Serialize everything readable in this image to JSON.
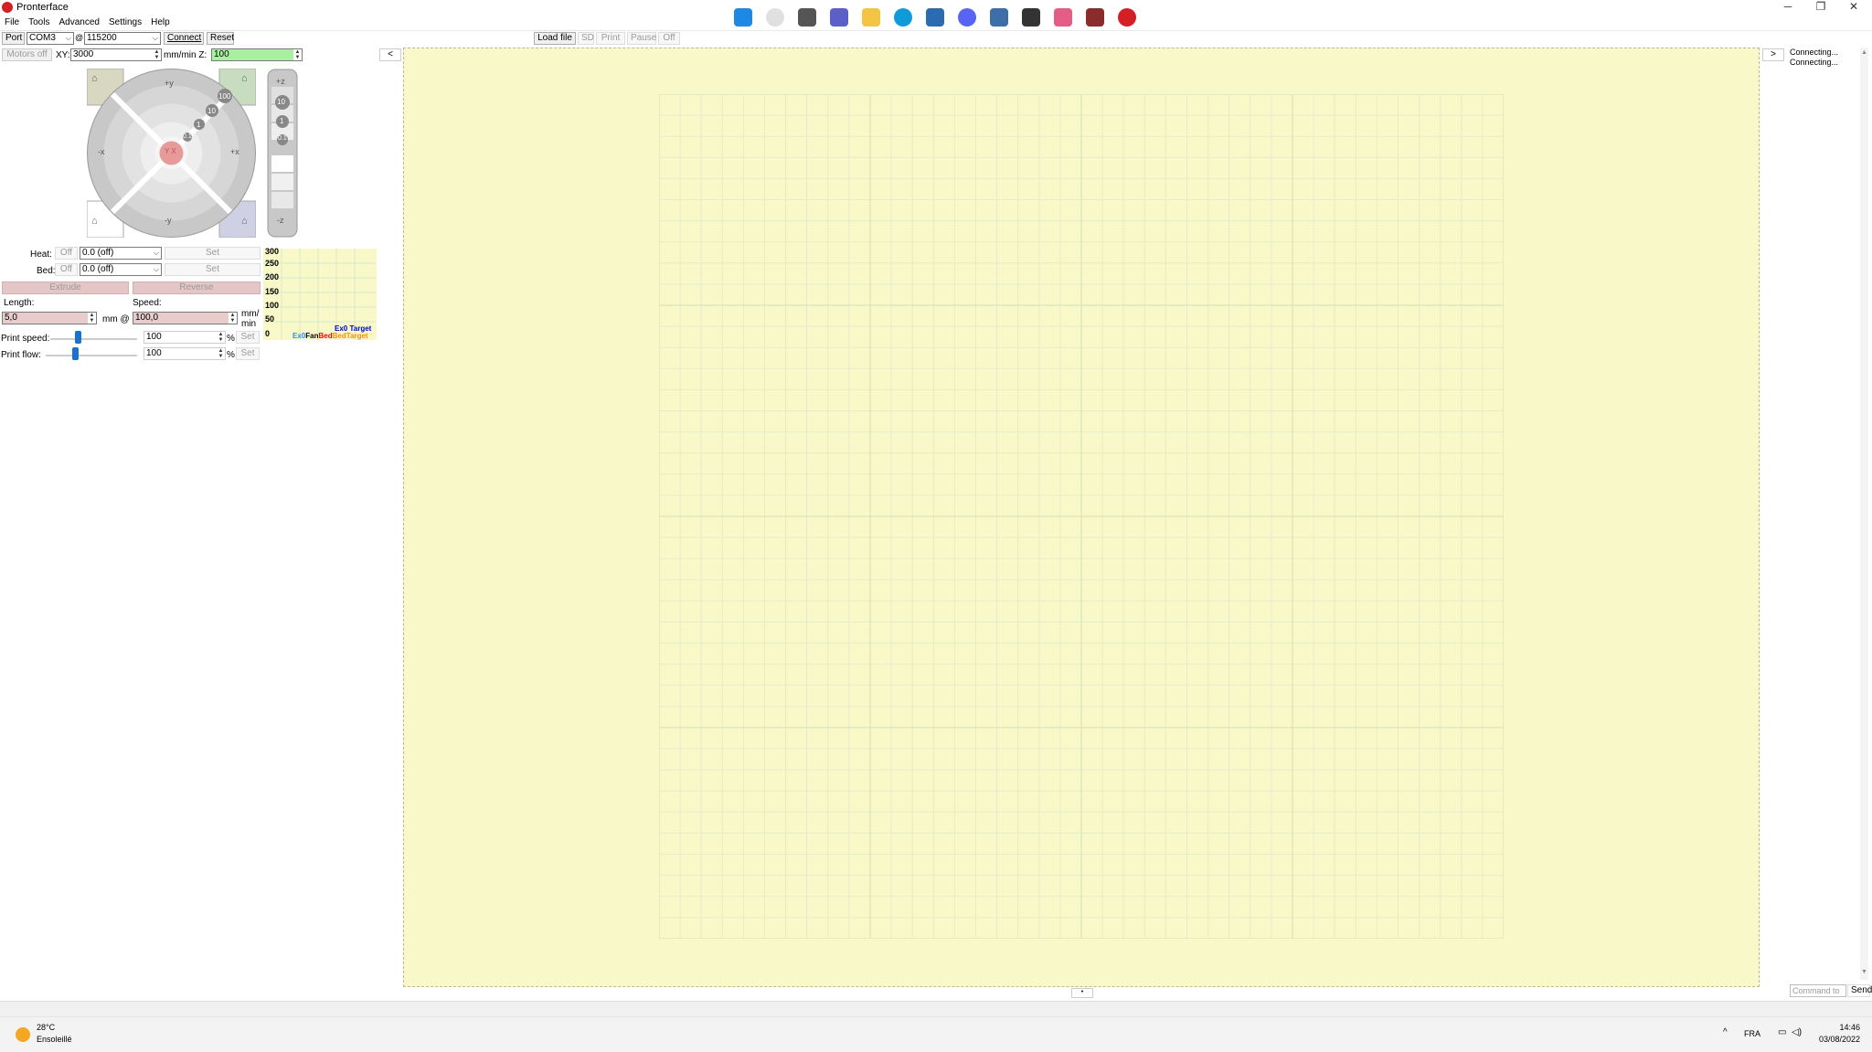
{
  "window": {
    "title": "Pronterface"
  },
  "menu": [
    "File",
    "Tools",
    "Advanced",
    "Settings",
    "Help"
  ],
  "connection": {
    "port_label": "Port",
    "port_value": "COM3",
    "at": "@",
    "baud_value": "115200",
    "connect_label": "Connect",
    "reset_label": "Reset"
  },
  "motors": {
    "motors_off_label": "Motors off",
    "xy_label": "XY:",
    "xy_value": "3000",
    "unit_label": "mm/min Z:",
    "z_value": "100"
  },
  "jog": {
    "plus_y": "+y",
    "minus_y": "-y",
    "plus_x": "+x",
    "minus_x": "-x",
    "steps": [
      "100",
      "10",
      "1",
      "0.1"
    ],
    "plus_z": "+z",
    "minus_z": "-z",
    "z_steps": [
      "10",
      "1",
      "0.1"
    ],
    "center_label": "Y X"
  },
  "temps": {
    "heat_label": "Heat:",
    "heat_state": "Off",
    "heat_value": "0.0 (off)",
    "heat_set": "Set",
    "bed_label": "Bed:",
    "bed_state": "Off",
    "bed_value": "0.0 (off)",
    "bed_set": "Set"
  },
  "extrude": {
    "extrude_label": "Extrude",
    "reverse_label": "Reverse",
    "length_label": "Length:",
    "speed_label": "Speed:",
    "length_value": "5,0",
    "mm_at": "mm @",
    "speed_value": "100,0",
    "unit1": "mm/",
    "unit2": "min"
  },
  "print_speed": {
    "label": "Print speed:",
    "value": "100",
    "unit": "%",
    "set": "Set",
    "level": 0.32
  },
  "print_flow": {
    "label": "Print flow:",
    "value": "100",
    "unit": "%",
    "set": "Set",
    "level": 0.32
  },
  "graph": {
    "yticks": [
      "300",
      "250",
      "200",
      "150",
      "100",
      "50",
      "0"
    ],
    "legend_top": "Ex0 Target",
    "legend_bottom": [
      {
        "text": "Ex0",
        "color": "#1e90ff"
      },
      {
        "text": "Fan",
        "color": "#000000"
      },
      {
        "text": "Bed",
        "color": "#ff0000"
      },
      {
        "text": "Bed",
        "color": "#ff8c00"
      },
      {
        "text": "Target",
        "color": "#ff8c00"
      }
    ]
  },
  "toolbar": {
    "load_file": "Load file",
    "sd": "SD",
    "print": "Print",
    "pause": "Pause",
    "off": "Off"
  },
  "nav": {
    "left": "<",
    "right": ">"
  },
  "console": {
    "lines": [
      "Connecting...",
      "Connecting..."
    ],
    "command_placeholder": "Command to",
    "send_label": "Send"
  },
  "taskbar": {
    "weather_temp": "28°C",
    "weather_desc": "Ensoleillé",
    "lang": "FRA",
    "time": "14:46",
    "date": "03/08/2022"
  }
}
